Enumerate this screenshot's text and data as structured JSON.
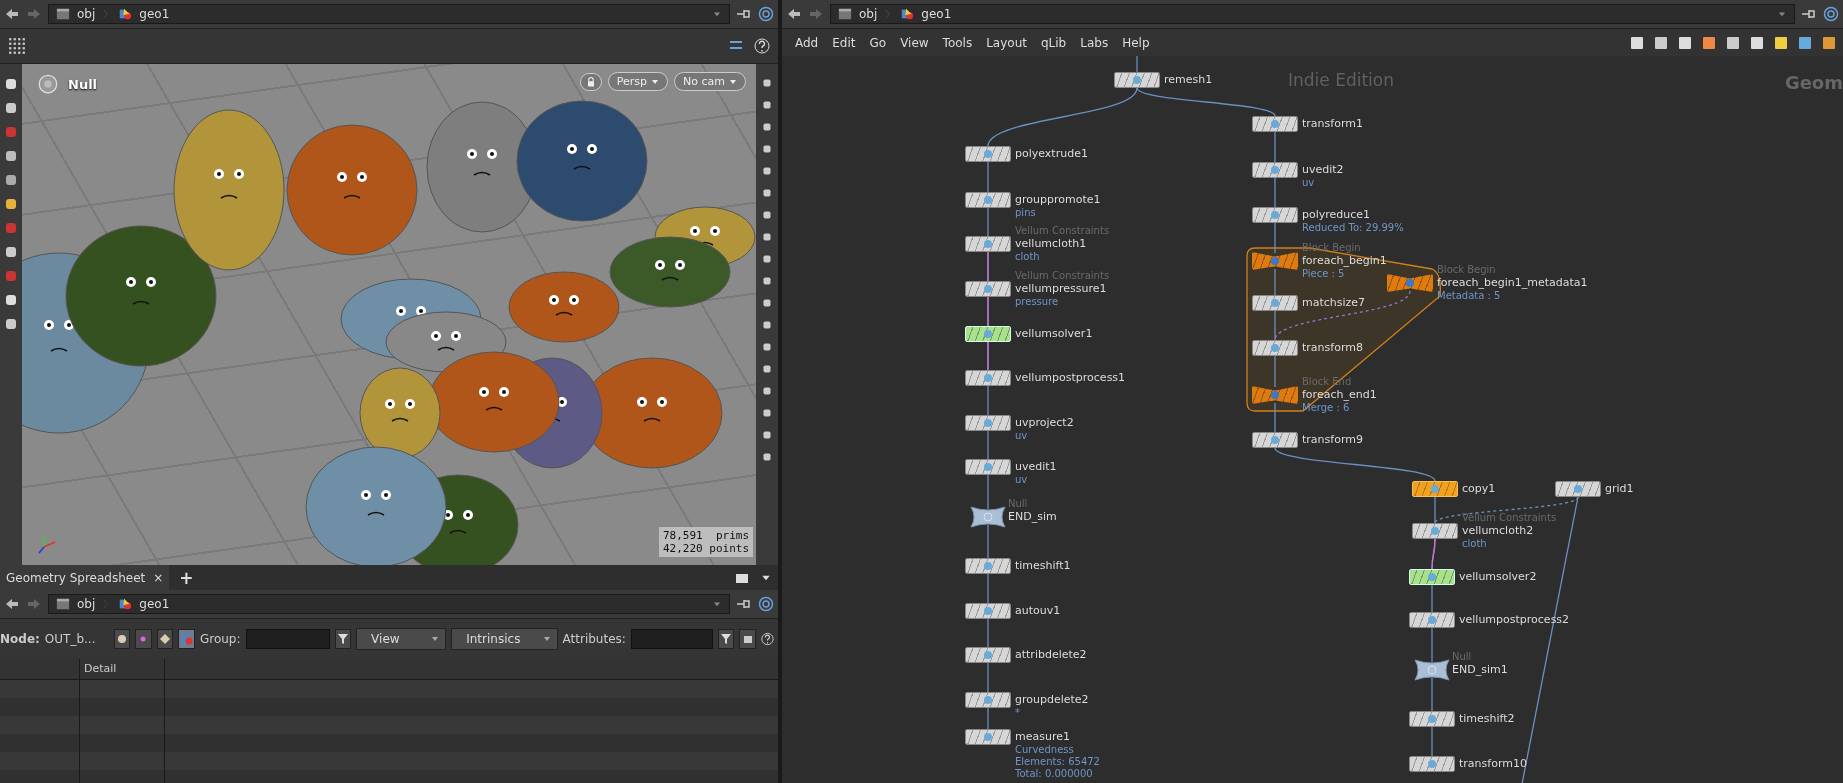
{
  "viewer": {
    "path": [
      "obj",
      "geo1"
    ],
    "tool_label": "Null",
    "camera_buttons": [
      "Persp",
      "No cam"
    ],
    "stats": [
      "78,591  prims",
      "42,220 points"
    ]
  },
  "spreadsheet": {
    "tabs": [
      {
        "label": "Geometry Spreadsheet",
        "selected": true
      }
    ],
    "close": "×",
    "add_tab": "+",
    "path": [
      "obj",
      "geo1"
    ],
    "node_label": "Node:",
    "node_value": "OUT_b...",
    "group_label": "Group:",
    "view": "View",
    "intrinsics": "Intrinsics",
    "attributes_label": "Attributes:",
    "columns": [
      "Detail"
    ]
  },
  "network": {
    "path": [
      "obj",
      "geo1"
    ],
    "menu": [
      "Add",
      "Edit",
      "Go",
      "View",
      "Tools",
      "Layout",
      "qLib",
      "Labs",
      "Help"
    ],
    "edition_label": "Indie Edition",
    "context_label": "Geom",
    "nodes": [
      {
        "name": "remesh1",
        "kind": "normal"
      },
      {
        "name": "polyextrude1",
        "kind": "normal"
      },
      {
        "name": "grouppromote1",
        "kind": "normal",
        "info": [
          "pins"
        ]
      },
      {
        "name": "vellumcloth1",
        "kind": "normal",
        "header": "Vellum Constraints",
        "info": [
          "cloth"
        ]
      },
      {
        "name": "vellumpressure1",
        "kind": "normal",
        "header": "Vellum Constraints",
        "info": [
          "pressure"
        ]
      },
      {
        "name": "vellumsolver1",
        "kind": "solver"
      },
      {
        "name": "vellumpostprocess1",
        "kind": "normal"
      },
      {
        "name": "uvproject2",
        "kind": "normal",
        "info": [
          "uv"
        ]
      },
      {
        "name": "uvedit1",
        "kind": "normal",
        "info": [
          "uv"
        ]
      },
      {
        "name": "END_sim",
        "kind": "null",
        "header": "Null"
      },
      {
        "name": "timeshift1",
        "kind": "normal"
      },
      {
        "name": "autouv1",
        "kind": "normal"
      },
      {
        "name": "attribdelete2",
        "kind": "normal"
      },
      {
        "name": "groupdelete2",
        "kind": "normal",
        "info": [
          "*"
        ]
      },
      {
        "name": "measure1",
        "kind": "normal",
        "info": [
          "Curvedness",
          "Elements: 65472",
          "Total: 0.000000"
        ]
      },
      {
        "name": "transform1",
        "kind": "normal"
      },
      {
        "name": "uvedit2",
        "kind": "normal",
        "info": [
          "uv"
        ]
      },
      {
        "name": "polyreduce1",
        "kind": "normal",
        "info": [
          "Reduced To: 29.99%"
        ]
      },
      {
        "name": "foreach_begin1",
        "kind": "block",
        "header": "Block Begin",
        "info": [
          "Piece : 5"
        ]
      },
      {
        "name": "foreach_begin1_metadata1",
        "kind": "block",
        "header": "Block Begin",
        "info": [
          "Metadata : 5"
        ]
      },
      {
        "name": "matchsize7",
        "kind": "normal"
      },
      {
        "name": "transform8",
        "kind": "normal"
      },
      {
        "name": "foreach_end1",
        "kind": "block",
        "header": "Block End",
        "info": [
          "Merge : 6"
        ]
      },
      {
        "name": "transform9",
        "kind": "normal"
      },
      {
        "name": "copy1",
        "kind": "copy"
      },
      {
        "name": "grid1",
        "kind": "normal"
      },
      {
        "name": "vellumcloth2",
        "kind": "normal",
        "header": "Vellum Constraints",
        "info": [
          "cloth"
        ]
      },
      {
        "name": "vellumsolver2",
        "kind": "solver"
      },
      {
        "name": "vellumpostprocess2",
        "kind": "normal"
      },
      {
        "name": "END_sim1",
        "kind": "null",
        "header": "Null"
      },
      {
        "name": "timeshift2",
        "kind": "normal"
      },
      {
        "name": "transform10",
        "kind": "normal"
      }
    ]
  }
}
